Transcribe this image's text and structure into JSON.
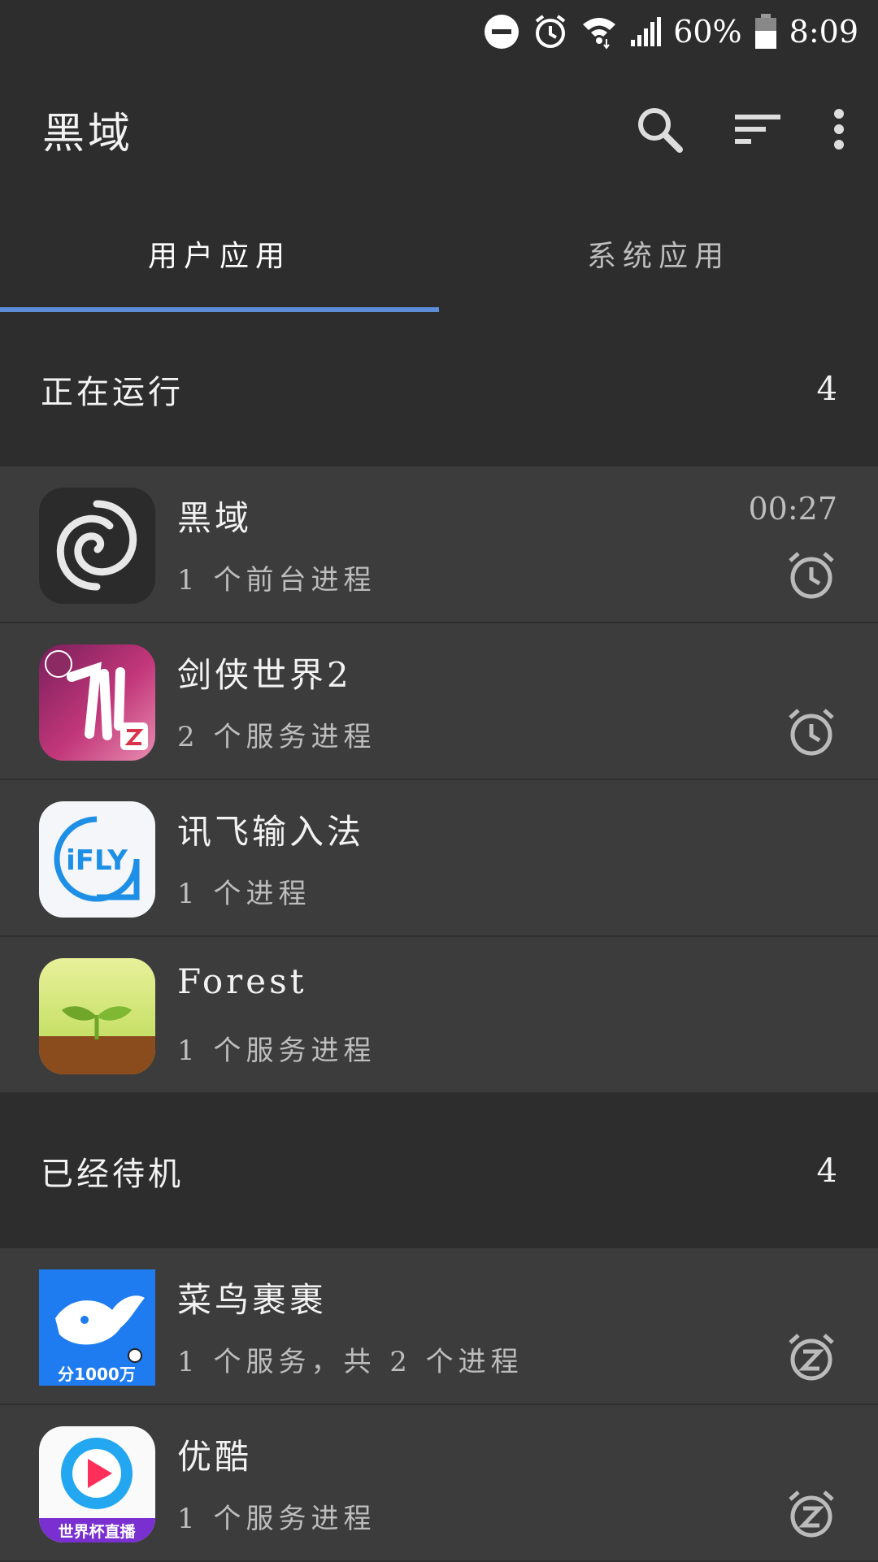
{
  "status": {
    "battery": "60%",
    "time": "8:09",
    "icons": [
      "dnd-icon",
      "alarm-icon",
      "wifi-icon",
      "signal-icon",
      "battery-icon"
    ]
  },
  "appbar": {
    "title": "黑域",
    "icons": [
      "search-icon",
      "sort-icon",
      "more-vert-icon"
    ]
  },
  "tabs": [
    {
      "label": "用户应用",
      "active": true
    },
    {
      "label": "系统应用",
      "active": false
    }
  ],
  "running": {
    "title": "正在运行",
    "count": "4",
    "items": [
      {
        "name": "黑域",
        "sub": "1 个前台进程",
        "time": "00:27",
        "action_icon": "alarm-clock-icon"
      },
      {
        "name": "剑侠世界2",
        "sub": "2 个服务进程",
        "action_icon": "alarm-clock-icon"
      },
      {
        "name": "讯飞输入法",
        "sub": "1 个进程"
      },
      {
        "name": "Forest",
        "sub": "1 个服务进程"
      }
    ]
  },
  "standby": {
    "title": "已经待机",
    "count": "4",
    "items": [
      {
        "name": "菜鸟裹裹",
        "sub": "1 个服务，共 2 个进程",
        "icon_badge": "分1000万",
        "action_icon": "snooze-icon"
      },
      {
        "name": "优酷",
        "sub": "1 个服务进程",
        "icon_badge": "世界杯直播",
        "action_icon": "snooze-icon"
      }
    ]
  },
  "colors": {
    "accent": "#5b8dd9",
    "background": "#2d2d2d",
    "row": "#3c3c3c"
  }
}
